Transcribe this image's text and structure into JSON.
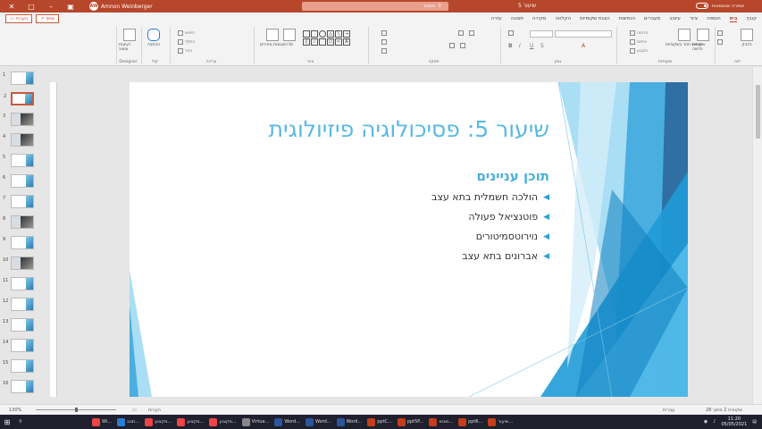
{
  "titlebar": {
    "user_name": "Amnon Weinberger",
    "avatar_initials": "AW",
    "search_placeholder": "חיפוש",
    "doc_title": "שיעור 5",
    "autosave_label": "שמירה אוטומטית"
  },
  "share": {
    "share_label": "שתף",
    "comments_label": "הערות"
  },
  "tabs": [
    "קובץ",
    "בית",
    "הוספה",
    "ציור",
    "עיצוב",
    "מעברים",
    "הנפשות",
    "הצגת שקופיות",
    "הקלטה",
    "סקירה",
    "תצוגה",
    "עזרה"
  ],
  "active_tab": "בית",
  "ribbon": {
    "groups": {
      "clipboard": "לוח",
      "slides": "שקופיות",
      "font": "גופן",
      "paragraph": "פסקה",
      "drawing": "ציור",
      "editing": "עריכה",
      "voice": "קול",
      "designer": "Designer"
    },
    "buttons": {
      "paste": "הדבק",
      "new_slide": "שקופית חדשה",
      "reuse_slides": "שימוש חוזר בשקופיות",
      "layout": "פריסה",
      "reset": "איפוס",
      "section": "מקטע",
      "shapes": "צורות",
      "arrange": "סדר",
      "quick_styles": "סגנונות מהירים",
      "find": "חיפוש",
      "replace": "החלף",
      "select": "בחר",
      "dictate": "הכתבה",
      "design_ideas": "רעיונות עיצוב"
    }
  },
  "slide": {
    "title": "שיעור 5: פסיכולוגיה פיזיולוגית",
    "subtitle": "תוכן עניינים",
    "bullets": [
      "הולכה חשמלית בתא עצב",
      "פוטנציאל פעולה",
      "נוירוטסמיטורים",
      "אברונים בתא עצב"
    ],
    "accent_color": "#58b9e4"
  },
  "thumbnails": [
    "1",
    "2",
    "3",
    "4",
    "5",
    "6",
    "7",
    "8",
    "9",
    "10",
    "11",
    "12",
    "13",
    "14",
    "15",
    "16"
  ],
  "selected_slide": 2,
  "status": {
    "slide_info": "שקופית 2 מתוך 28",
    "language": "עברית",
    "zoom": "130%",
    "notes": "הערות"
  },
  "taskbar": {
    "items": [
      "Wi...",
      "תוכנ...",
      "מקצוע...",
      "מקצוע...",
      "מקצוע...",
      "Virtua...",
      "Word...",
      "Word...",
      "Word...",
      "pptC...",
      "ppt5P...",
      "מבוא...",
      "ppt6...",
      "שיעור..."
    ],
    "time": "11:20",
    "date": "05/05/2021"
  }
}
